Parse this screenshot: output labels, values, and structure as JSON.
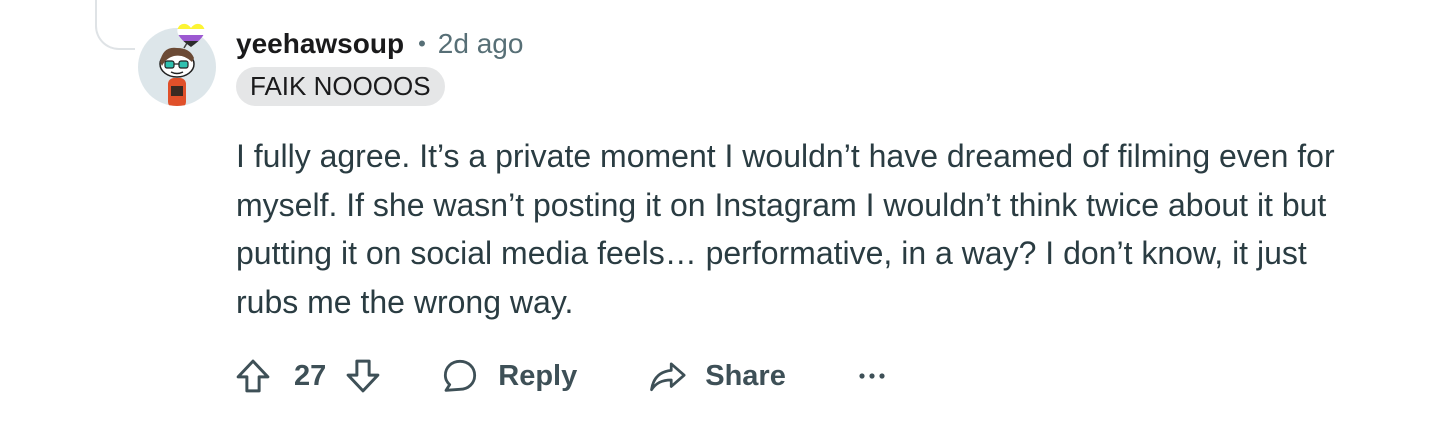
{
  "comment": {
    "username": "yeehawsoup",
    "separator": "•",
    "timestamp": "2d ago",
    "flair": "FAIK NOOOOS",
    "body": "I fully agree. It’s a private moment I wouldn’t have dreamed of filming even for myself. If she wasn’t posting it on Instagram I wouldn’t think twice about it but putting it on social media feels… performative, in a way? I don’t know, it just rubs me the wrong way.",
    "vote_count": "27",
    "actions": {
      "reply_label": "Reply",
      "share_label": "Share",
      "more_label": "•••"
    }
  },
  "icons": {
    "upvote": "upvote-arrow-icon",
    "downvote": "downvote-arrow-icon",
    "reply": "speech-bubble-icon",
    "share": "share-arrow-icon",
    "more": "more-dots-icon",
    "avatar_badge": "heart-icon"
  },
  "colors": {
    "text_primary": "#1a1a1b",
    "text_body": "#2a3c42",
    "text_secondary": "#576f76",
    "action_text": "#3e5057",
    "flair_bg": "#e5e6e7",
    "thread_line": "#dfe3e6",
    "avatar_bg": "#dde6ea"
  }
}
